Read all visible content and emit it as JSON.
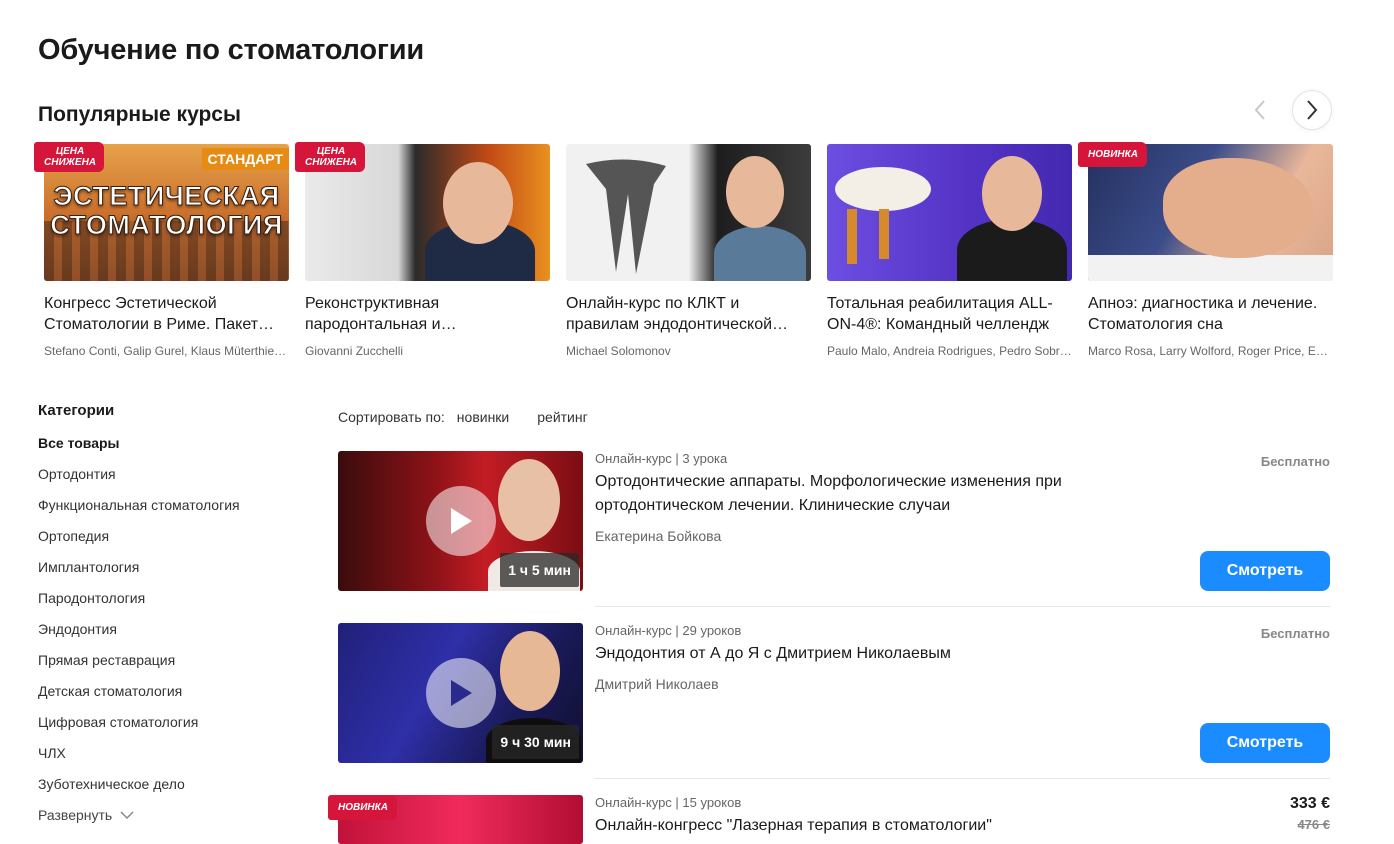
{
  "page": {
    "title": "Обучение по стоматологии"
  },
  "popular": {
    "title": "Популярные курсы",
    "cards": [
      {
        "badge": "ЦЕНА СНИЖЕНА",
        "thumb_text": "ЭСТЕТИЧЕСКАЯ СТОМАТОЛОГИЯ",
        "thumb_tag": "СТАНДАРТ",
        "title": "Конгресс Эстетической Стоматологии в Риме. Пакет…",
        "authors": "Stefano Conti, Galip Gurel, Klaus Müterthies…"
      },
      {
        "badge": "ЦЕНА СНИЖЕНА",
        "title": "Реконструктивная пародонтальная и…",
        "authors": "Giovanni Zucchelli"
      },
      {
        "badge": "",
        "title": "Онлайн-курс по КЛКТ и правилам эндодонтической…",
        "authors": "Michael Solomonov"
      },
      {
        "badge": "",
        "title": "Тотальная реабилитация ALL-ON-4®: Командный челлендж",
        "authors": "Paulo Malo, Andreia Rodrigues, Pedro Sobr…"
      },
      {
        "badge": "НОВИНКА",
        "title": "Апноэ: диагностика и лечение. Стоматология сна",
        "authors": "Marco Rosa, Larry Wolford, Roger Price, Ed…"
      }
    ]
  },
  "categories": {
    "heading": "Категории",
    "items": [
      "Все товары",
      "Ортодонтия",
      "Функциональная стоматология",
      "Ортопедия",
      "Имплантология",
      "Пародонтология",
      "Эндодонтия",
      "Прямая реставрация",
      "Детская стоматология",
      "Цифровая стоматология",
      "ЧЛХ",
      "Зуботехническое дело"
    ],
    "expand_label": "Развернуть"
  },
  "sort": {
    "label": "Сортировать по:",
    "options": [
      "новинки",
      "рейтинг"
    ]
  },
  "listings": [
    {
      "meta": "Онлайн-курс | 3 урока",
      "title": "Ортодонтические аппараты. Морфологические изменения при ортодонтическом лечении. Клинические случаи",
      "author": "Екатерина Бойкова",
      "duration": "1 ч 5 мин",
      "price": "Бесплатно",
      "button": "Смотреть"
    },
    {
      "meta": "Онлайн-курс | 29 уроков",
      "title": "Эндодонтия от А до Я с Дмитрием Николаевым",
      "author": "Дмитрий Николаев",
      "duration": "9 ч 30 мин",
      "price": "Бесплатно",
      "button": "Смотреть"
    },
    {
      "badge": "НОВИНКА",
      "meta": "Онлайн-курс | 15 уроков",
      "title": "Онлайн-конгресс \"Лазерная терапия в стоматологии\"",
      "price_now": "333 €",
      "price_old": "476 €"
    }
  ],
  "colors": {
    "accent": "#1a8cff",
    "badge": "#d6153b"
  }
}
